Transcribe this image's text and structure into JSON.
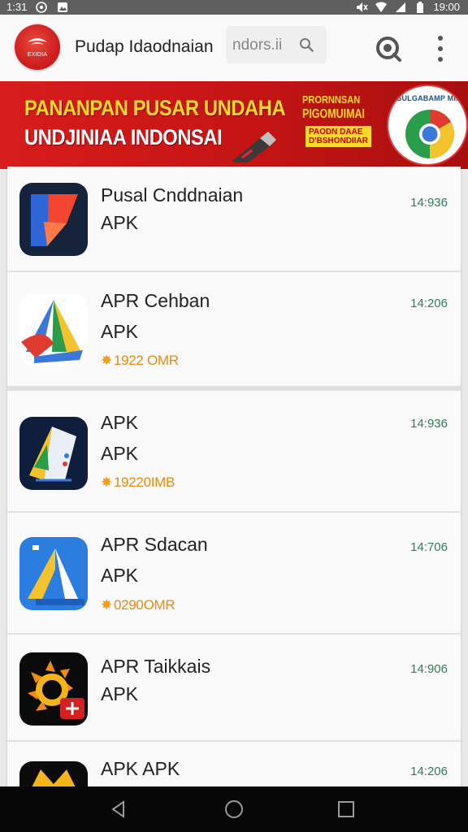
{
  "status_bar": {
    "left_text": "1:31",
    "right_time": "19:00",
    "icons": [
      "whatsapp-icon",
      "image-icon",
      "mute-icon",
      "wifi-icon",
      "signal-icon",
      "battery-icon"
    ]
  },
  "app_bar": {
    "title": "Pudap Idaodnaian",
    "search_text": "ndors.ii",
    "logo_text": "EXIDIA",
    "icons": [
      "search-icon",
      "lens-icon",
      "more-vert-icon"
    ]
  },
  "banner": {
    "line1": "PANANPAN PUSAR UNDAHA",
    "line2": "UNDJINIAA INDONSAI",
    "promo1": "PRORNNSAN",
    "promo2": "PIGOMUIMAI",
    "promo3": "PAODN DAAE",
    "promo4": "D'BSHONDIIAR",
    "badge_text": "ISULGABAMP MIAI",
    "colors": {
      "background": "#d81c1c",
      "headline_yellow": "#ffd92a"
    }
  },
  "apps": [
    {
      "name": "Pusal Cnddnaian",
      "type": "APK",
      "rating": "",
      "time": "14:936",
      "icon": "red-blue-logo-icon"
    },
    {
      "name": "APR Cehban",
      "type": "APK",
      "rating": "1922 OMR",
      "time": "14:206",
      "icon": "colorful-a-logo-icon"
    },
    {
      "name": "APK",
      "type": "APK",
      "rating": "19220IMB",
      "time": "14:936",
      "icon": "navy-a-logo-icon"
    },
    {
      "name": "APR Sdacan",
      "type": "APK",
      "rating": "0290OMR",
      "time": "14:706",
      "icon": "blue-a-logo-icon"
    },
    {
      "name": "APR Taikkais",
      "type": "APK",
      "rating": "",
      "time": "14:906",
      "icon": "sun-logo-icon"
    },
    {
      "name": "APK APK",
      "type": "",
      "rating": "",
      "time": "14:206",
      "icon": "crown-logo-icon"
    }
  ],
  "nav_bar": {
    "buttons": [
      "back-icon",
      "home-icon",
      "recents-icon"
    ]
  }
}
